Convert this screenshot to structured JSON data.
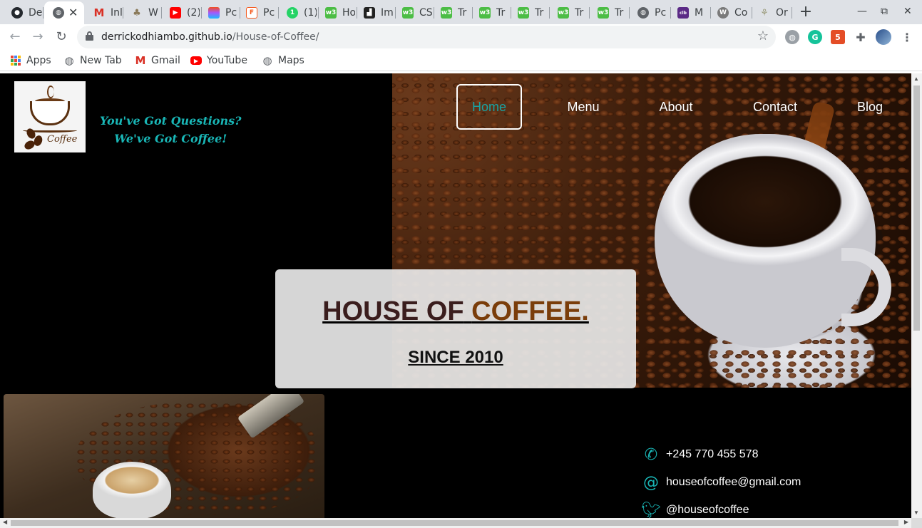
{
  "browser": {
    "tabs": [
      {
        "label": "De",
        "icon": "github-icon",
        "color": "#24292e"
      },
      {
        "label": "",
        "icon": "globe-icon",
        "color": "#5f6368",
        "active": true
      },
      {
        "label": "Inl",
        "icon": "gmail-icon",
        "color": "#d93025"
      },
      {
        "label": "W",
        "icon": "tree-icon",
        "color": "#8a7a5a"
      },
      {
        "label": "(2)",
        "icon": "youtube-icon",
        "color": "#ff0000"
      },
      {
        "label": "Pc",
        "icon": "figma-icon",
        "color": "#a259ff"
      },
      {
        "label": "Pc",
        "icon": "flipboard-icon",
        "color": "#f55a1f"
      },
      {
        "label": "(1)",
        "icon": "whatsapp-icon",
        "color": "#25d366"
      },
      {
        "label": "Ho",
        "icon": "w3schools-icon",
        "color": "#4cbd45"
      },
      {
        "label": "Im",
        "icon": "github-pages-icon",
        "color": "#222222"
      },
      {
        "label": "CS",
        "icon": "w3schools-icon",
        "color": "#4cbd45"
      },
      {
        "label": "Tr",
        "icon": "w3schools-icon",
        "color": "#4cbd45"
      },
      {
        "label": "Tr",
        "icon": "w3schools-icon",
        "color": "#4cbd45"
      },
      {
        "label": "Tr",
        "icon": "w3schools-icon",
        "color": "#4cbd45"
      },
      {
        "label": "Tr",
        "icon": "w3schools-icon",
        "color": "#4cbd45"
      },
      {
        "label": "Tr",
        "icon": "w3schools-icon",
        "color": "#4cbd45"
      },
      {
        "label": "Pc",
        "icon": "globe-icon",
        "color": "#5f6368"
      },
      {
        "label": "M",
        "icon": "colorlib-icon",
        "color": "#5b2a86"
      },
      {
        "label": "Co",
        "icon": "wordpress-icon",
        "color": "#7a7a7a"
      },
      {
        "label": "Or",
        "icon": "plant-icon",
        "color": "#9a9a7a"
      }
    ],
    "new_tab_symbol": "+",
    "window_controls": {
      "minimize": "—",
      "restore": "⧉",
      "close": "✕"
    },
    "url_host": "derrickodhiambo.github.io",
    "url_path": "/House-of-Coffee/",
    "bookmarks": [
      {
        "label": "Apps",
        "icon": "apps-grid-icon"
      },
      {
        "label": "New Tab",
        "icon": "globe-icon"
      },
      {
        "label": "Gmail",
        "icon": "gmail-icon"
      },
      {
        "label": "YouTube",
        "icon": "youtube-icon"
      },
      {
        "label": "Maps",
        "icon": "globe-icon"
      }
    ]
  },
  "site": {
    "logo_text": "Coffee",
    "tagline_line1": "You've Got Questions?",
    "tagline_line2": "We've Got Coffee!",
    "nav": [
      {
        "label": "Home",
        "active": true
      },
      {
        "label": "Menu"
      },
      {
        "label": "About"
      },
      {
        "label": "Contact"
      },
      {
        "label": "Blog"
      }
    ],
    "hero_title_part1": "HOUSE OF",
    "hero_title_part2": "COFFEE.",
    "hero_subtitle": "SINCE 2010",
    "contact": [
      {
        "icon": "phone-icon",
        "text": "+245 770 455 578"
      },
      {
        "icon": "at-icon",
        "text": "houseofcoffee@gmail.com"
      },
      {
        "icon": "twitter-icon",
        "text": "@houseofcoffee"
      }
    ],
    "colors": {
      "accent": "#19b6b6",
      "title_dark": "#3a1d1d",
      "title_brown": "#7a3d0a"
    }
  }
}
